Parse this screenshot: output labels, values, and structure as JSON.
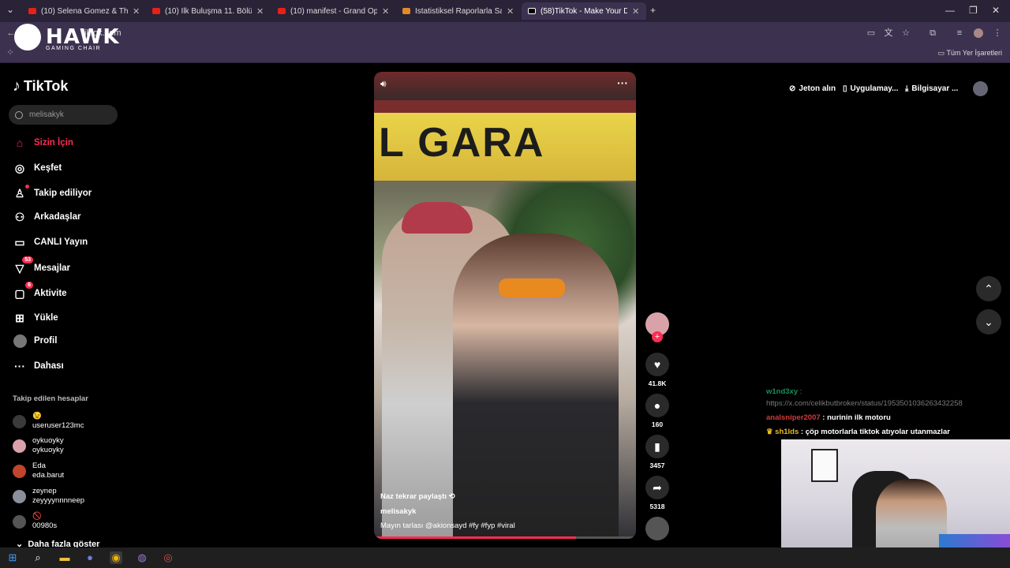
{
  "browser": {
    "tabs": [
      {
        "label": "(10) Selena Gomez & The Scene"
      },
      {
        "label": "(10) İlk Buluşma 11. Bölüm - Yo"
      },
      {
        "label": "(10) manifest - Grand Opening"
      },
      {
        "label": "İstatistiksel Raporlarla Saflık Te"
      },
      {
        "label": "(58)TikTok - Make Your Day"
      }
    ],
    "url": "tiktok.com",
    "all_bookmarks": "Tüm Yer İşaretleri"
  },
  "overlay_brand": {
    "word": "HAWK",
    "sub": "GAMING CHAIR"
  },
  "tiktok": {
    "logo": "TikTok",
    "search_placeholder": "melisakyk",
    "nav": [
      {
        "label": "Sizin İçin",
        "icon": "home-icon"
      },
      {
        "label": "Keşfet",
        "icon": "compass-icon"
      },
      {
        "label": "Takip ediliyor",
        "icon": "following-icon"
      },
      {
        "label": "Arkadaşlar",
        "icon": "friends-icon"
      },
      {
        "label": "CANLI Yayın",
        "icon": "live-icon"
      },
      {
        "label": "Mesajlar",
        "icon": "messages-icon",
        "badge": "53"
      },
      {
        "label": "Aktivite",
        "icon": "activity-icon",
        "badge": "6"
      },
      {
        "label": "Yükle",
        "icon": "upload-icon"
      },
      {
        "label": "Profil",
        "icon": "profile-icon"
      },
      {
        "label": "Dahası",
        "icon": "more-icon"
      }
    ],
    "following_title": "Takip edilen hesaplar",
    "following": [
      {
        "line1": "😉",
        "line2": "useruser123mc",
        "color": "#3a3a3a"
      },
      {
        "line1": "oykuoyky",
        "line2": "oykuoyky",
        "color": "#d9a2a9"
      },
      {
        "line1": "Eda",
        "line2": "eda.barut",
        "color": "#c0452c"
      },
      {
        "line1": "zeynep",
        "line2": "zeyyyynnnneep",
        "color": "#8b8f9c"
      },
      {
        "line1": "🚫",
        "line2": "00980s",
        "color": "#555"
      }
    ],
    "show_more": "Daha fazla göster",
    "top_right": {
      "coins": "Jeton alın",
      "app": "Uygulamay...",
      "desktop": "Bilgisayar ..."
    }
  },
  "video": {
    "sign_text": "L GARA",
    "repost_line": "Naz tekrar paylaştı",
    "username": "melisakyk",
    "caption": "Mayın tarlası @akionsayd #fy #fyp #viral",
    "progress": 0.77
  },
  "actions": {
    "likes": "41.8K",
    "comments": "160",
    "saves": "3457",
    "shares": "5318"
  },
  "chat": [
    {
      "user": "w1nd3xy",
      "text": "https://x.com/celikbutbroken/status/1953501036263432258"
    },
    {
      "user": "analsniper2007",
      "text": "nurinin ilk motoru"
    },
    {
      "user": "sh1lds",
      "text": "çöp motorlarla tiktok atıyolar utanmazlar"
    }
  ],
  "colors": {
    "accent": "#fe2c55",
    "chrome_bg": "#3c3250"
  }
}
